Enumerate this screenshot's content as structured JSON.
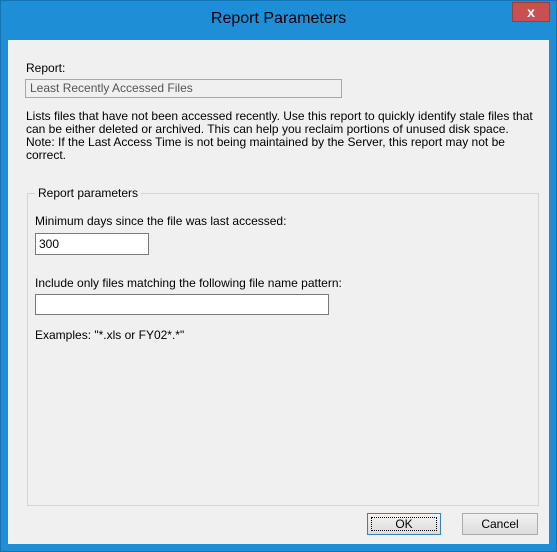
{
  "window": {
    "title": "Report Parameters",
    "close_label": "x"
  },
  "report": {
    "label": "Report:",
    "name": "Least Recently Accessed Files",
    "description": "Lists files that have not been accessed recently. Use this report to quickly identify stale files that can be either deleted or archived. This can help you reclaim portions of unused disk space. Note: If the Last Access Time is not being maintained by the Server, this report may not be correct."
  },
  "parameters": {
    "group_label": "Report parameters",
    "min_days_label": "Minimum days since the file was last accessed:",
    "min_days_value": "300",
    "pattern_label": "Include only files matching the following file name pattern:",
    "pattern_value": "",
    "examples_text": "Examples: \"*.xls or FY02*.*\""
  },
  "buttons": {
    "ok_label": "OK",
    "cancel_label": "Cancel"
  }
}
